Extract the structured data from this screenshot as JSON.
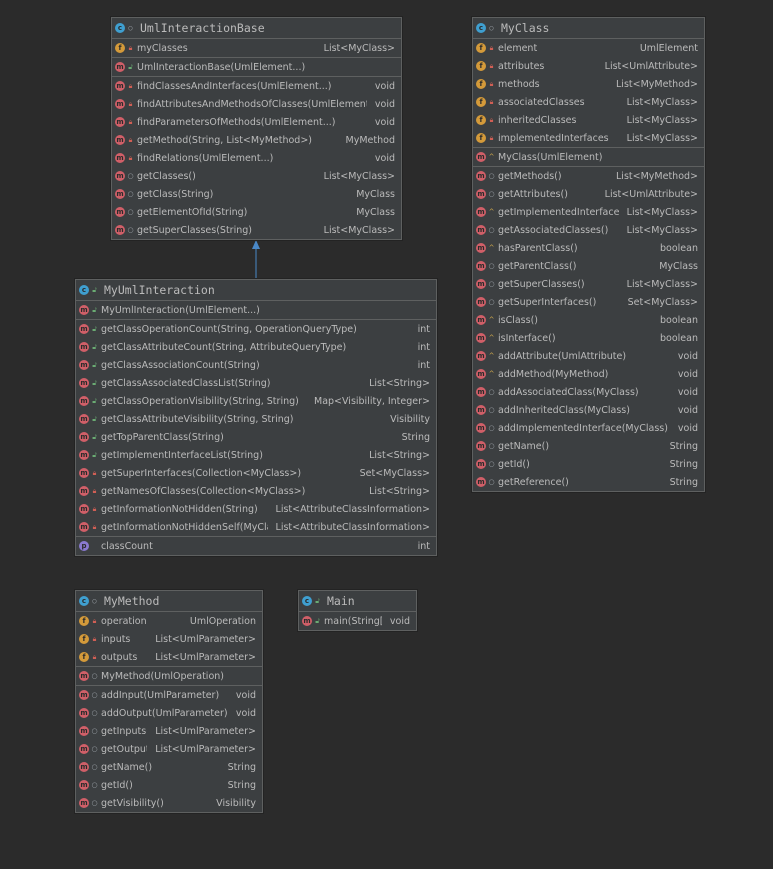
{
  "colors": {
    "background": "#2b2b2b",
    "panel": "#3c3f41",
    "border": "#5e6060",
    "text": "#bbbbbb",
    "class_icon": "#3f9fd0",
    "method_icon": "#d05f68",
    "field_icon": "#d49a3a",
    "property_icon": "#8a7ad0",
    "arrow": "#4a88c7"
  },
  "classes": {
    "base": {
      "name": "UmlInteractionBase",
      "vis": "pkg",
      "fields": [
        {
          "kind": "f",
          "vis": "priv",
          "name": "myClasses",
          "type": "List<MyClass>"
        }
      ],
      "constructors": [
        {
          "kind": "m",
          "vis": "pub",
          "name": "UmlInteractionBase(UmlElement...)",
          "type": ""
        }
      ],
      "methods": [
        {
          "kind": "m",
          "vis": "priv",
          "name": "findClassesAndInterfaces(UmlElement...)",
          "type": "void"
        },
        {
          "kind": "m",
          "vis": "priv",
          "name": "findAttributesAndMethodsOfClasses(UmlElement...)",
          "type": "void"
        },
        {
          "kind": "m",
          "vis": "priv",
          "name": "findParametersOfMethods(UmlElement...)",
          "type": "void"
        },
        {
          "kind": "m",
          "vis": "priv",
          "name": "getMethod(String, List<MyMethod>)",
          "type": "MyMethod"
        },
        {
          "kind": "m",
          "vis": "priv",
          "name": "findRelations(UmlElement...)",
          "type": "void"
        },
        {
          "kind": "m",
          "vis": "pkg",
          "name": "getClasses()",
          "type": "List<MyClass>"
        },
        {
          "kind": "m",
          "vis": "pkg",
          "name": "getClass(String)",
          "type": "MyClass"
        },
        {
          "kind": "m",
          "vis": "pkg",
          "name": "getElementOfId(String)",
          "type": "MyClass"
        },
        {
          "kind": "m",
          "vis": "pkg",
          "name": "getSuperClasses(String)",
          "type": "List<MyClass>"
        }
      ]
    },
    "myclass": {
      "name": "MyClass",
      "vis": "pkg",
      "fields": [
        {
          "kind": "f",
          "vis": "priv",
          "name": "element",
          "type": "UmlElement"
        },
        {
          "kind": "f",
          "vis": "priv",
          "name": "attributes",
          "type": "List<UmlAttribute>"
        },
        {
          "kind": "f",
          "vis": "priv",
          "name": "methods",
          "type": "List<MyMethod>"
        },
        {
          "kind": "f",
          "vis": "priv",
          "name": "associatedClasses",
          "type": "List<MyClass>"
        },
        {
          "kind": "f",
          "vis": "priv",
          "name": "inheritedClasses",
          "type": "List<MyClass>"
        },
        {
          "kind": "f",
          "vis": "priv",
          "name": "implementedInterfaces",
          "type": "List<MyClass>"
        }
      ],
      "constructors": [
        {
          "kind": "m",
          "vis": "prot",
          "name": "MyClass(UmlElement)",
          "type": ""
        }
      ],
      "methods": [
        {
          "kind": "m",
          "vis": "pkg",
          "name": "getMethods()",
          "type": "List<MyMethod>"
        },
        {
          "kind": "m",
          "vis": "pkg",
          "name": "getAttributes()",
          "type": "List<UmlAttribute>"
        },
        {
          "kind": "m",
          "vis": "prot",
          "name": "getImplementedInterfaces()",
          "type": "List<MyClass>"
        },
        {
          "kind": "m",
          "vis": "pkg",
          "name": "getAssociatedClasses()",
          "type": "List<MyClass>"
        },
        {
          "kind": "m",
          "vis": "prot",
          "name": "hasParentClass()",
          "type": "boolean"
        },
        {
          "kind": "m",
          "vis": "pkg",
          "name": "getParentClass()",
          "type": "MyClass"
        },
        {
          "kind": "m",
          "vis": "pkg",
          "name": "getSuperClasses()",
          "type": "List<MyClass>"
        },
        {
          "kind": "m",
          "vis": "pkg",
          "name": "getSuperInterfaces()",
          "type": "Set<MyClass>"
        },
        {
          "kind": "m",
          "vis": "prot",
          "name": "isClass()",
          "type": "boolean"
        },
        {
          "kind": "m",
          "vis": "prot",
          "name": "isInterface()",
          "type": "boolean"
        },
        {
          "kind": "m",
          "vis": "prot",
          "name": "addAttribute(UmlAttribute)",
          "type": "void"
        },
        {
          "kind": "m",
          "vis": "prot",
          "name": "addMethod(MyMethod)",
          "type": "void"
        },
        {
          "kind": "m",
          "vis": "pkg",
          "name": "addAssociatedClass(MyClass)",
          "type": "void"
        },
        {
          "kind": "m",
          "vis": "pkg",
          "name": "addInheritedClass(MyClass)",
          "type": "void"
        },
        {
          "kind": "m",
          "vis": "pkg",
          "name": "addImplementedInterface(MyClass)",
          "type": "void"
        },
        {
          "kind": "m",
          "vis": "pkg",
          "name": "getName()",
          "type": "String"
        },
        {
          "kind": "m",
          "vis": "pkg",
          "name": "getId()",
          "type": "String"
        },
        {
          "kind": "m",
          "vis": "pkg",
          "name": "getReference()",
          "type": "String"
        }
      ]
    },
    "interaction": {
      "name": "MyUmlInteraction",
      "vis": "pub",
      "constructors": [
        {
          "kind": "m",
          "vis": "pub",
          "name": "MyUmlInteraction(UmlElement...)",
          "type": ""
        }
      ],
      "methods": [
        {
          "kind": "m",
          "vis": "pub",
          "name": "getClassOperationCount(String, OperationQueryType)",
          "type": "int"
        },
        {
          "kind": "m",
          "vis": "pub",
          "name": "getClassAttributeCount(String, AttributeQueryType)",
          "type": "int"
        },
        {
          "kind": "m",
          "vis": "pub",
          "name": "getClassAssociationCount(String)",
          "type": "int"
        },
        {
          "kind": "m",
          "vis": "pub",
          "name": "getClassAssociatedClassList(String)",
          "type": "List<String>"
        },
        {
          "kind": "m",
          "vis": "pub",
          "name": "getClassOperationVisibility(String, String)",
          "type": "Map<Visibility, Integer>"
        },
        {
          "kind": "m",
          "vis": "pub",
          "name": "getClassAttributeVisibility(String, String)",
          "type": "Visibility"
        },
        {
          "kind": "m",
          "vis": "pub",
          "name": "getTopParentClass(String)",
          "type": "String"
        },
        {
          "kind": "m",
          "vis": "pub",
          "name": "getImplementInterfaceList(String)",
          "type": "List<String>"
        },
        {
          "kind": "m",
          "vis": "priv",
          "name": "getSuperInterfaces(Collection<MyClass>)",
          "type": "Set<MyClass>"
        },
        {
          "kind": "m",
          "vis": "priv",
          "name": "getNamesOfClasses(Collection<MyClass>)",
          "type": "List<String>"
        },
        {
          "kind": "m",
          "vis": "priv",
          "name": "getInformationNotHidden(String)",
          "type": "List<AttributeClassInformation>"
        },
        {
          "kind": "m",
          "vis": "priv",
          "name": "getInformationNotHiddenSelf(MyClass)",
          "type": "List<AttributeClassInformation>"
        }
      ],
      "properties": [
        {
          "kind": "p",
          "vis": "",
          "name": "classCount",
          "type": "int"
        }
      ]
    },
    "mymethod": {
      "name": "MyMethod",
      "vis": "pkg",
      "fields": [
        {
          "kind": "f",
          "vis": "priv",
          "name": "operation",
          "type": "UmlOperation"
        },
        {
          "kind": "f",
          "vis": "priv",
          "name": "inputs",
          "type": "List<UmlParameter>"
        },
        {
          "kind": "f",
          "vis": "priv",
          "name": "outputs",
          "type": "List<UmlParameter>"
        }
      ],
      "constructors": [
        {
          "kind": "m",
          "vis": "pkg",
          "name": "MyMethod(UmlOperation)",
          "type": ""
        }
      ],
      "methods": [
        {
          "kind": "m",
          "vis": "pkg",
          "name": "addInput(UmlParameter)",
          "type": "void"
        },
        {
          "kind": "m",
          "vis": "pkg",
          "name": "addOutput(UmlParameter)",
          "type": "void"
        },
        {
          "kind": "m",
          "vis": "pkg",
          "name": "getInputs()",
          "type": "List<UmlParameter>"
        },
        {
          "kind": "m",
          "vis": "pkg",
          "name": "getOutputs()",
          "type": "List<UmlParameter>"
        },
        {
          "kind": "m",
          "vis": "pkg",
          "name": "getName()",
          "type": "String"
        },
        {
          "kind": "m",
          "vis": "pkg",
          "name": "getId()",
          "type": "String"
        },
        {
          "kind": "m",
          "vis": "pkg",
          "name": "getVisibility()",
          "type": "Visibility"
        }
      ]
    },
    "main": {
      "name": "Main",
      "vis": "pub",
      "methods": [
        {
          "kind": "ms",
          "vis": "pub",
          "name": "main(String[])",
          "type": "void"
        }
      ]
    }
  }
}
